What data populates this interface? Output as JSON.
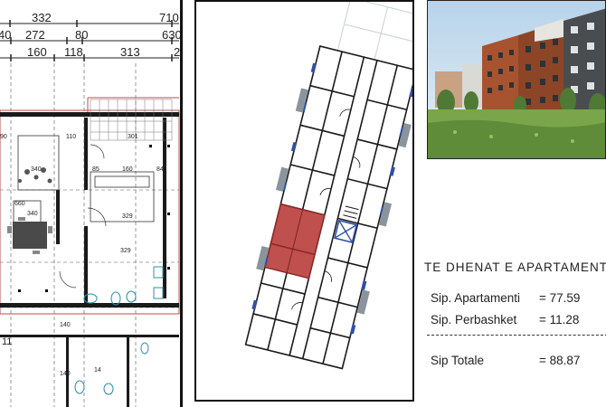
{
  "floor_plan": {
    "dimensions_top": [
      "332",
      "710",
      "272",
      "80",
      "630",
      "160",
      "118",
      "313",
      "40",
      "2"
    ],
    "room_labels": [
      "90",
      "110",
      "301",
      "340",
      "85",
      "160",
      "84",
      "660",
      "340",
      "329",
      "329",
      "140",
      "11",
      "14",
      "140"
    ]
  },
  "apartment_data": {
    "title": "TE DHENAT E APARTAMENTIT",
    "rows": [
      {
        "label": "Sip. Apartamenti",
        "value": "= 77.59"
      },
      {
        "label": "Sip. Perbashket",
        "value": "= 11.28"
      }
    ],
    "total": {
      "label": "Sip Totale",
      "value": "= 88.87"
    }
  },
  "colors": {
    "wall": "#111111",
    "highlight": "#c0504d",
    "window_blue": "#2f4fa8",
    "brick": "#b5532e",
    "sky": "#cfe3f2"
  },
  "icons": [
    "stair-icon",
    "toilet-icon",
    "sink-icon",
    "table-icon"
  ]
}
